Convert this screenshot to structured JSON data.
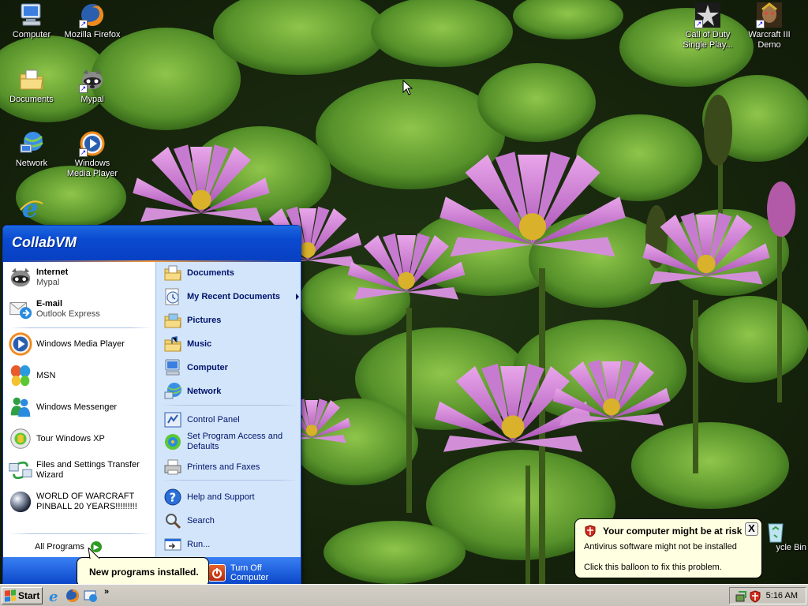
{
  "desktop": {
    "icons": [
      {
        "label": "Computer",
        "icon": "computer-icon"
      },
      {
        "label": "Mozilla Firefox",
        "icon": "firefox-icon"
      },
      {
        "label": "Documents",
        "icon": "documents-folder-icon"
      },
      {
        "label": "Mypal",
        "icon": "mypal-icon"
      },
      {
        "label": "Network",
        "icon": "network-icon"
      },
      {
        "label": "Windows Media Player",
        "label_line1": "Windows",
        "label_line2": "Media Player",
        "icon": "media-player-icon"
      },
      {
        "label": "Internet Explorer",
        "icon": "ie-icon"
      },
      {
        "label_line1": "Call of Duty",
        "label_line2": "Single Play...",
        "icon": "call-of-duty-icon"
      },
      {
        "label_line1": "Warcraft III",
        "label_line2": "Demo",
        "icon": "warcraft-icon"
      },
      {
        "label": "Recycle Bin",
        "visible_text": "ycle Bin",
        "icon": "recycle-bin-icon"
      }
    ]
  },
  "start_menu": {
    "user_name": "CollabVM",
    "pinned": [
      {
        "title": "Internet",
        "subtitle": "Mypal",
        "icon": "mypal-icon"
      },
      {
        "title": "E-mail",
        "subtitle": "Outlook Express",
        "icon": "email-icon"
      }
    ],
    "recent": [
      {
        "label": "Windows Media Player",
        "icon": "media-player-icon"
      },
      {
        "label": "MSN",
        "icon": "msn-butterfly-icon"
      },
      {
        "label": "Windows Messenger",
        "icon": "messenger-icon"
      },
      {
        "label": "Tour Windows XP",
        "icon": "tour-icon"
      },
      {
        "label_line1": "Files and Settings Transfer",
        "label_line2": "Wizard",
        "icon": "transfer-wizard-icon"
      },
      {
        "label_line1": "WORLD OF WARCRAFT",
        "label_line2": "PINBALL 20 YEARS!!!!!!!!!",
        "icon": "pinball-icon"
      }
    ],
    "all_programs": "All Programs",
    "right": [
      {
        "label": "Documents",
        "bold": true,
        "icon": "documents-folder-icon"
      },
      {
        "label": "My Recent Documents",
        "bold": true,
        "icon": "recent-docs-icon",
        "submenu": true
      },
      {
        "label": "Pictures",
        "bold": true,
        "icon": "pictures-folder-icon"
      },
      {
        "label": "Music",
        "bold": true,
        "icon": "music-folder-icon"
      },
      {
        "label": "Computer",
        "bold": true,
        "icon": "computer-icon"
      },
      {
        "label": "Network",
        "bold": true,
        "icon": "network-icon"
      },
      {
        "label": "Control Panel",
        "icon": "control-panel-icon"
      },
      {
        "label_line1": "Set Program Access and",
        "label_line2": "Defaults",
        "icon": "program-access-icon"
      },
      {
        "label": "Printers and Faxes",
        "icon": "printer-icon"
      },
      {
        "label": "Help and Support",
        "icon": "help-icon"
      },
      {
        "label": "Search",
        "icon": "search-icon"
      },
      {
        "label": "Run...",
        "icon": "run-icon"
      }
    ],
    "turn_off": "Turn Off Computer"
  },
  "balloons": {
    "new_programs": "New programs installed.",
    "risk": {
      "title": "Your computer might be at risk",
      "line1": "Antivirus software might not be installed",
      "line2": "Click this balloon to fix this problem.",
      "close": "X"
    }
  },
  "taskbar": {
    "start_label": "Start",
    "quick_launch_more": "»",
    "clock": "5:16 AM"
  },
  "colors": {
    "start_menu_header": "#0a4ad0",
    "start_menu_right_pane": "#d3e5fa",
    "balloon_bg": "#ffffe1",
    "taskbar": "#d4d0c8"
  }
}
